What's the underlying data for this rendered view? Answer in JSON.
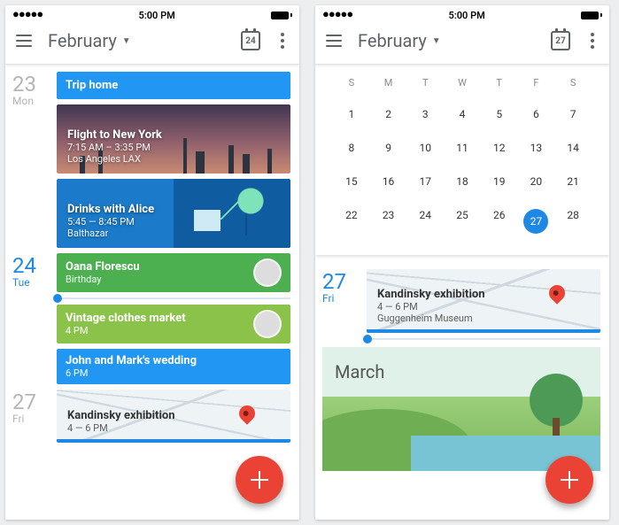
{
  "left": {
    "status_time": "5:00 PM",
    "title": "February",
    "today_badge": "24",
    "days": [
      {
        "num": "23",
        "wk": "Mon",
        "hot": false,
        "events": [
          {
            "kind": "bar",
            "color": "#2196F3",
            "title": "Trip home"
          },
          {
            "kind": "imgcard",
            "bgclass": "nyc",
            "title": "Flight to New York",
            "time": "7:15 AM – 3:35 PM",
            "place": "Los Angeles LAX"
          },
          {
            "kind": "imgcard",
            "bgclass": "drinks",
            "title": "Drinks with Alice",
            "time": "5:45 — 8:45 PM",
            "place": "Balthazar"
          }
        ]
      },
      {
        "num": "24",
        "wk": "Tue",
        "hot": true,
        "events": [
          {
            "kind": "avatar",
            "color": "#4CAF50",
            "title": "Oana Florescu",
            "sub": "Birthday"
          }
        ],
        "after_timeline": [
          {
            "kind": "avatar",
            "color": "#8BC34A",
            "title": "Vintage clothes market",
            "sub": "4 PM"
          },
          {
            "kind": "bar2",
            "color": "#2196F3",
            "title": "John and Mark's wedding",
            "sub": "6 PM"
          }
        ]
      },
      {
        "num": "27",
        "wk": "Fri",
        "hot": false,
        "events": [
          {
            "kind": "mapcard",
            "title": "Kandinsky exhibition",
            "sub": "4 — 6 PM"
          }
        ]
      }
    ]
  },
  "right": {
    "status_time": "5:00 PM",
    "title": "February",
    "today_badge": "27",
    "weekdays": [
      "S",
      "M",
      "T",
      "W",
      "T",
      "F",
      "S"
    ],
    "weeks": [
      [
        "1",
        "2",
        "3",
        "4",
        "5",
        "6",
        "7"
      ],
      [
        "8",
        "9",
        "10",
        "11",
        "12",
        "13",
        "14"
      ],
      [
        "15",
        "16",
        "17",
        "18",
        "19",
        "20",
        "21"
      ],
      [
        "22",
        "23",
        "24",
        "25",
        "26",
        "27",
        "28"
      ]
    ],
    "selected": "27",
    "day": {
      "num": "27",
      "wk": "Fri",
      "event": {
        "title": "Kandinsky exhibition",
        "time": "4 — 6 PM",
        "place": "Guggenheim Museum"
      }
    },
    "next_month": "March"
  }
}
